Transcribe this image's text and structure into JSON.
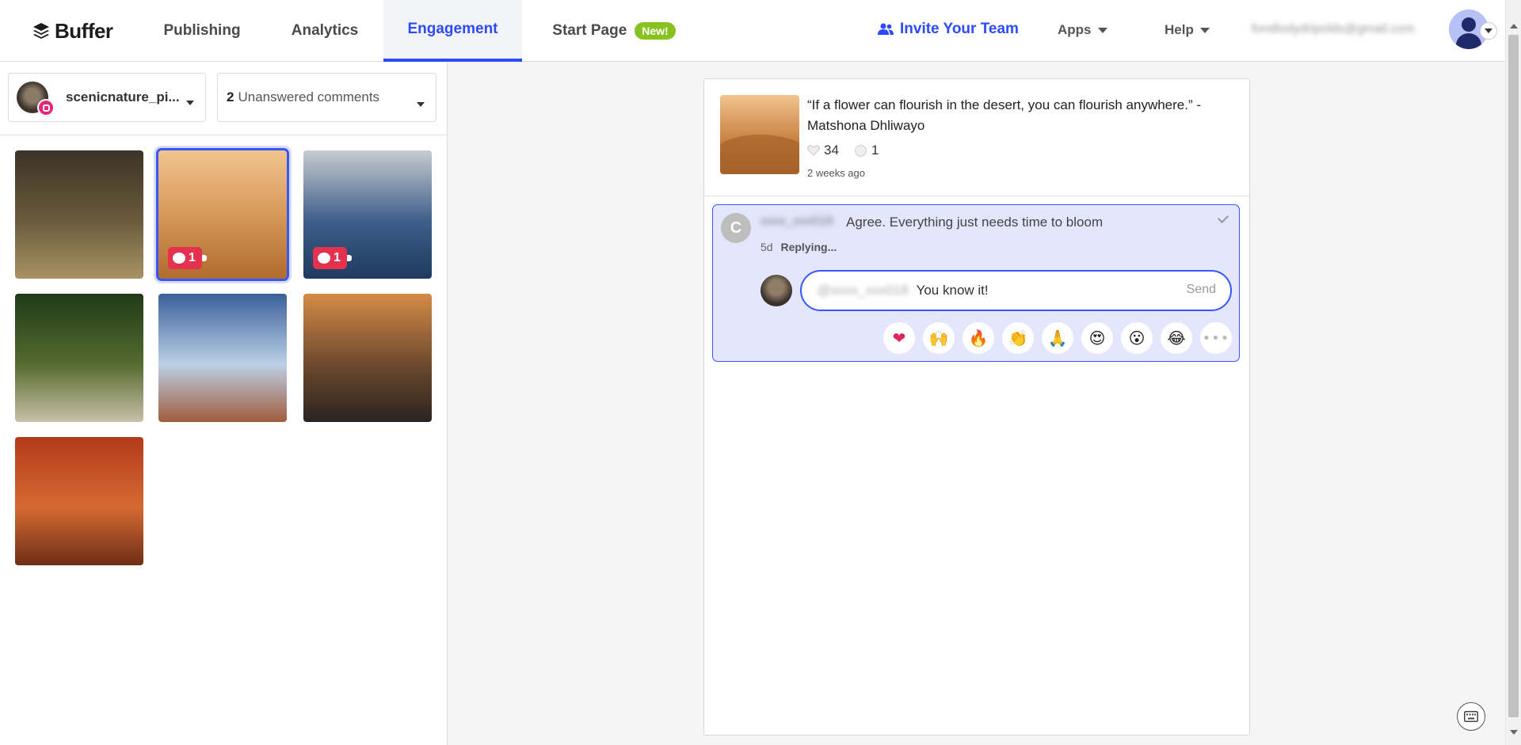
{
  "nav": {
    "logo": "Buffer",
    "tabs": [
      {
        "label": "Publishing"
      },
      {
        "label": "Analytics"
      },
      {
        "label": "Engagement"
      },
      {
        "label": "Start Page",
        "badge": "New!"
      }
    ],
    "active_tab": "Engagement",
    "invite": "Invite Your Team",
    "apps": "Apps",
    "help": "Help",
    "email": "fondlodydripolds@gmail.com"
  },
  "left": {
    "account_name": "scenicnature_pi...",
    "comments_count": "2",
    "comments_label": "Unanswered comments",
    "thumbnails": [
      {
        "name": "forest-sunbeams",
        "colors": [
          "#3b3326",
          "#6b5b3d",
          "#a89364"
        ],
        "comments": null
      },
      {
        "name": "desert-dunes",
        "colors": [
          "#f1c58f",
          "#d39454",
          "#b06b2d"
        ],
        "comments": "1",
        "selected": true
      },
      {
        "name": "ocean-waves",
        "colors": [
          "#c7ccd1",
          "#3d5f8a",
          "#1e3a5e"
        ],
        "comments": "1"
      },
      {
        "name": "tree-lined-road",
        "colors": [
          "#1f3a18",
          "#556b2f",
          "#c8c0a8"
        ],
        "comments": null
      },
      {
        "name": "desert-highway",
        "colors": [
          "#3a5f9a",
          "#bcd0e6",
          "#a05c3d"
        ],
        "comments": null
      },
      {
        "name": "sunset-sea",
        "colors": [
          "#d48b45",
          "#6e4a2e",
          "#2a2420"
        ],
        "comments": null
      },
      {
        "name": "autumn-forest",
        "colors": [
          "#b33a1a",
          "#d56a32",
          "#6e2e16"
        ],
        "comments": null
      }
    ]
  },
  "post": {
    "caption": "“If a flower can flourish in the desert, you can flourish anywhere.” - Matshona Dhliwayo",
    "likes": "34",
    "comments": "1",
    "time": "2 weeks ago"
  },
  "comment": {
    "initial": "C",
    "user": "xxxx_xxx018",
    "text": "Agree. Everything just needs time to bloom",
    "age": "5d",
    "status": "Replying...",
    "reply_mention": "@xxxx_xxx018",
    "reply_value": "You know it!",
    "send_label": "Send",
    "emojis": [
      "❤",
      "🙌",
      "🔥",
      "👏",
      "🙏",
      "😍",
      "😮",
      "😂"
    ],
    "more": "•••"
  },
  "colors": {
    "accent": "#2c4bff",
    "new_badge": "#87c221",
    "comment_badge": "#e3314f"
  }
}
